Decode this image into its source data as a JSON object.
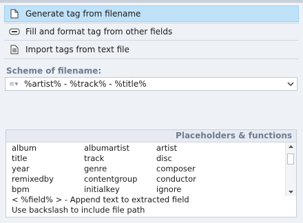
{
  "options": [
    {
      "label": "Generate tag from filename",
      "icon": "document-icon",
      "active": true
    },
    {
      "label": "Fill and format tag from other fields",
      "icon": "tag-fields-icon",
      "active": false
    },
    {
      "label": "Import tags from text file",
      "icon": "text-file-icon",
      "active": false
    }
  ],
  "scheme": {
    "label": "Scheme of filename:",
    "value": "%artist% - %track% - %title%"
  },
  "placeholders": {
    "title": "Placeholders & functions",
    "rows": [
      [
        "album",
        "albumartist",
        "artist"
      ],
      [
        "title",
        "track",
        "disc"
      ],
      [
        "year",
        "genre",
        "composer"
      ],
      [
        "remixedby",
        "contentgroup",
        "conductor"
      ],
      [
        "bpm",
        "initialkey",
        "ignore"
      ]
    ],
    "hints": [
      "< %field% > - Append text to extracted field",
      "Use backslash to include file path"
    ]
  },
  "colors": {
    "active_bg": "#bfe2f9",
    "section_label": "#6d7c92"
  }
}
